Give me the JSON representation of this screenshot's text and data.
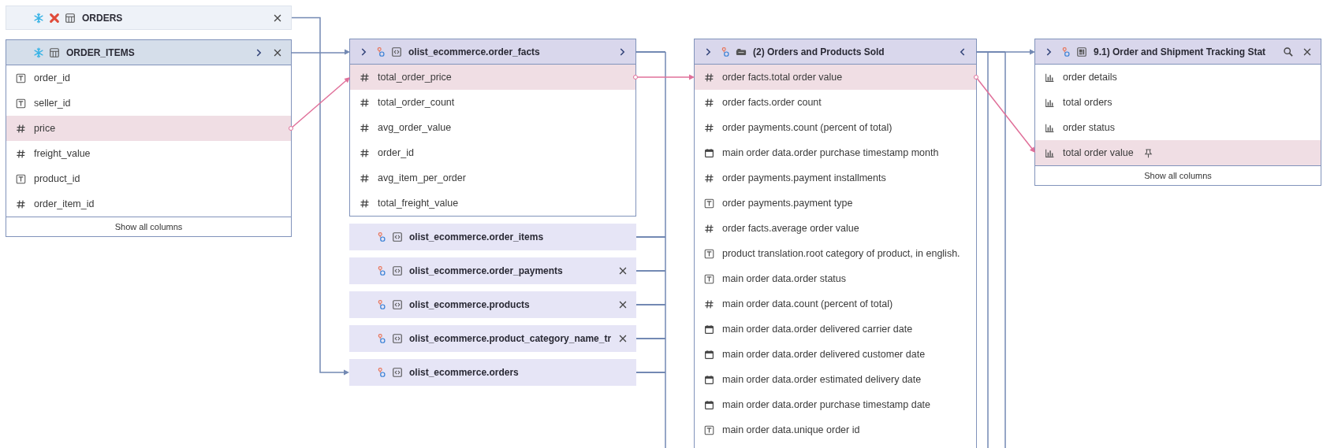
{
  "lanes": [
    {
      "nodes": [
        {
          "kind": "warehouse-table",
          "title": "ORDERS",
          "error": true,
          "expanded": false,
          "lead_chevron": false,
          "close": true,
          "feeds": true
        },
        {
          "kind": "warehouse-table",
          "title": "ORDER_ITEMS",
          "error": false,
          "expanded": true,
          "lead_chevron": false,
          "expand_columns": true,
          "close": true,
          "feeds": true,
          "columns": [
            {
              "kind": "text",
              "name": "order_id",
              "selected": false
            },
            {
              "kind": "text",
              "name": "seller_id",
              "selected": false
            },
            {
              "kind": "number",
              "name": "price",
              "selected": true
            },
            {
              "kind": "number",
              "name": "freight_value",
              "selected": false
            },
            {
              "kind": "text",
              "name": "product_id",
              "selected": false
            },
            {
              "kind": "number",
              "name": "order_item_id",
              "selected": false
            }
          ],
          "footer": "Show all columns"
        }
      ]
    },
    {
      "trunks": [
        {
          "kind": "downstream"
        }
      ],
      "nodes": [
        {
          "kind": "model",
          "title": "olist_ecommerce.order_facts",
          "expanded": true,
          "lead_chevron": true,
          "expand_columns": true,
          "fed": true,
          "downstream": true,
          "columns": [
            {
              "kind": "number",
              "name": "total_order_price",
              "selected": true
            },
            {
              "kind": "number",
              "name": "total_order_count",
              "selected": false
            },
            {
              "kind": "number",
              "name": "avg_order_value",
              "selected": false
            },
            {
              "kind": "number",
              "name": "order_id",
              "selected": false
            },
            {
              "kind": "number",
              "name": "avg_item_per_order",
              "selected": false
            },
            {
              "kind": "number",
              "name": "total_freight_value",
              "selected": false
            }
          ]
        },
        {
          "kind": "model",
          "title": "olist_ecommerce.order_items",
          "expanded": false,
          "lead_chevron": false,
          "close": false,
          "downstream": true
        },
        {
          "kind": "model",
          "title": "olist_ecommerce.order_payments",
          "expanded": false,
          "lead_chevron": false,
          "close": true,
          "downstream": true
        },
        {
          "kind": "model",
          "title": "olist_ecommerce.products",
          "expanded": false,
          "lead_chevron": false,
          "close": true,
          "downstream": true
        },
        {
          "kind": "model",
          "title": "olist_ecommerce.product_category_name_tr",
          "expanded": false,
          "lead_chevron": false,
          "close": true,
          "downstream": true
        },
        {
          "kind": "model",
          "title": "olist_ecommerce.orders",
          "expanded": false,
          "lead_chevron": false,
          "close": false,
          "fed": true,
          "downstream": true
        }
      ]
    },
    {
      "trunks": [
        {
          "kind": "downstream"
        },
        {
          "kind": "downstream"
        }
      ],
      "nodes": [
        {
          "kind": "explore",
          "title": "(2) Orders and Products Sold",
          "expanded": true,
          "lead_chevron": true,
          "collapse_columns": true,
          "feeds": true,
          "downstream": true,
          "cut_off": true,
          "columns": [
            {
              "kind": "number",
              "name": "order facts.total order value",
              "selected": true
            },
            {
              "kind": "number",
              "name": "order facts.order count",
              "selected": false
            },
            {
              "kind": "number",
              "name": "order payments.count (percent of total)",
              "selected": false
            },
            {
              "kind": "date",
              "name": "main order data.order purchase timestamp month",
              "selected": false
            },
            {
              "kind": "number",
              "name": "order payments.payment installments",
              "selected": false
            },
            {
              "kind": "text",
              "name": "order payments.payment type",
              "selected": false
            },
            {
              "kind": "number",
              "name": "order facts.average order value",
              "selected": false
            },
            {
              "kind": "text",
              "name": "product translation.root category of product, in english.",
              "selected": false
            },
            {
              "kind": "text",
              "name": "main order data.order status",
              "selected": false
            },
            {
              "kind": "number",
              "name": "main order data.count (percent of total)",
              "selected": false
            },
            {
              "kind": "date",
              "name": "main order data.order delivered carrier date",
              "selected": false
            },
            {
              "kind": "date",
              "name": "main order data.order delivered customer date",
              "selected": false
            },
            {
              "kind": "date",
              "name": "main order data.order estimated delivery date",
              "selected": false
            },
            {
              "kind": "date",
              "name": "main order data.order purchase timestamp date",
              "selected": false
            },
            {
              "kind": "text",
              "name": "main order data.unique order id",
              "selected": false
            }
          ]
        }
      ]
    },
    {
      "nodes": [
        {
          "kind": "dashboard",
          "title": "9.1) Order and Shipment Tracking Stat",
          "expanded": true,
          "lead_chevron": true,
          "search": true,
          "close": true,
          "fed": true,
          "columns": [
            {
              "kind": "measure",
              "name": "order details",
              "selected": false,
              "pinned": false
            },
            {
              "kind": "measure",
              "name": "total orders",
              "selected": false,
              "pinned": false
            },
            {
              "kind": "measure",
              "name": "order status",
              "selected": false,
              "pinned": false
            },
            {
              "kind": "measure",
              "name": "total order value",
              "selected": true,
              "pinned": true
            }
          ],
          "footer": "Show all columns"
        }
      ]
    }
  ]
}
